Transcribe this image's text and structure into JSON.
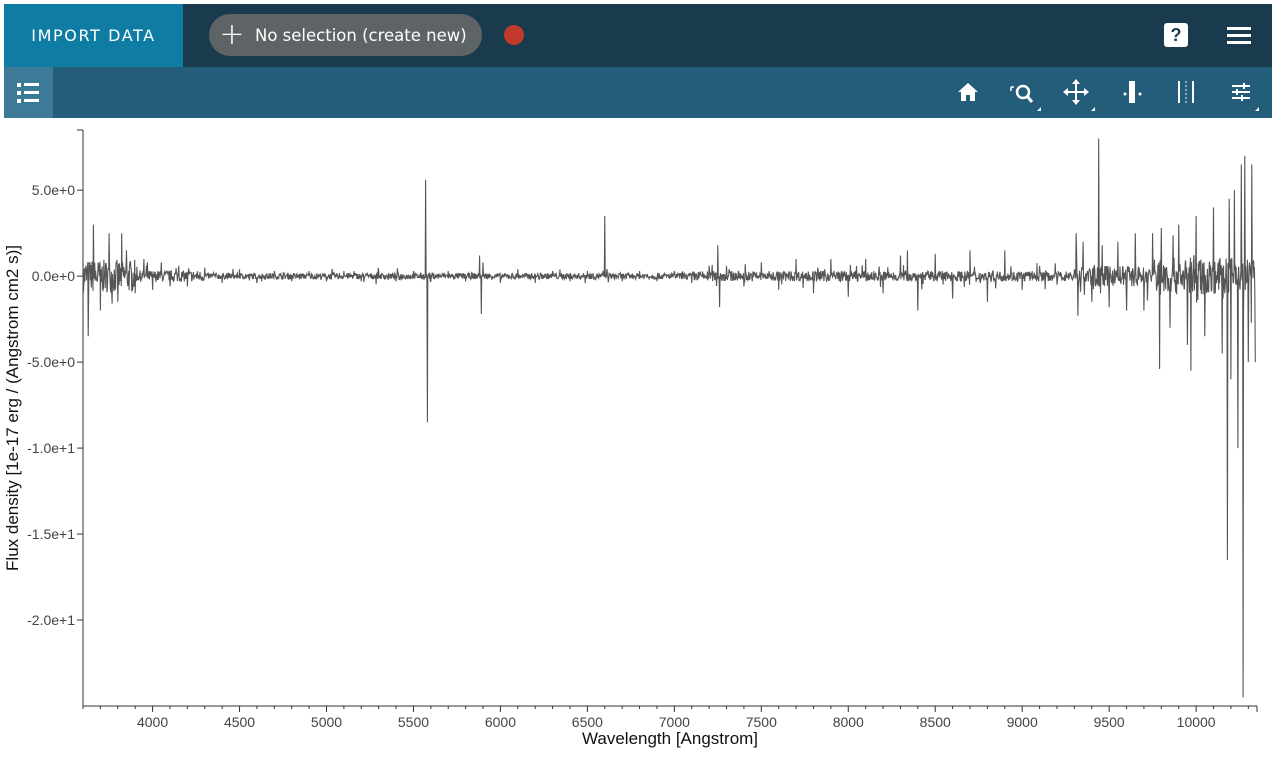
{
  "topbar": {
    "import_label": "IMPORT DATA",
    "selection_label": "No selection (create new)",
    "selection_icon": "plus-icon",
    "status_color": "#c23a2b",
    "help_label": "?",
    "help_icon": "help-icon",
    "menu_icon": "hamburger-menu-icon"
  },
  "toolbar": {
    "tools": [
      {
        "name": "home-icon"
      },
      {
        "name": "zoom-icon"
      },
      {
        "name": "pan-icon"
      },
      {
        "name": "single-pixel-select-icon"
      },
      {
        "name": "range-select-icon"
      },
      {
        "name": "settings-sliders-icon"
      }
    ],
    "colors": {
      "topbar": "#1a3a4d",
      "toolbar": "#245d7a",
      "import": "#0f7ca3"
    }
  },
  "chart_data": {
    "type": "line",
    "xlabel": "Wavelength [Angstrom]",
    "ylabel": "Flux density [1e-17 erg / (Angstrom cm2 s)]",
    "xlim": [
      3600,
      10350
    ],
    "ylim": [
      -25,
      8.5
    ],
    "xticks": [
      4000,
      4500,
      5000,
      5500,
      6000,
      6500,
      7000,
      7500,
      8000,
      8500,
      9000,
      9500,
      10000
    ],
    "xtick_labels": [
      "4000",
      "4500",
      "5000",
      "5500",
      "6000",
      "6500",
      "7000",
      "7500",
      "8000",
      "8500",
      "9000",
      "9500",
      "10000"
    ],
    "yticks": [
      5,
      0,
      -5,
      -10,
      -15,
      -20
    ],
    "ytick_labels": [
      "5.0e+0",
      "0.0e+0",
      "-5.0e+0",
      "-1.0e+1",
      "-1.5e+1",
      "-2.0e+1"
    ],
    "series_color": "#555555",
    "grid": false,
    "series": [
      {
        "x": [
          3600,
          3630,
          3660,
          3700,
          3750,
          3800,
          3850,
          3900,
          3950,
          4000,
          4050,
          4100,
          4150,
          4200,
          4300,
          4400,
          4500,
          4600,
          4700,
          4800,
          4900,
          5000,
          5100,
          5200,
          5300,
          5400,
          5500,
          5570,
          5580,
          5590,
          5600,
          5700,
          5800,
          5880,
          5890,
          5900,
          6000,
          6100,
          6200,
          6300,
          6400,
          6500,
          6590,
          6600,
          6610,
          6700,
          6800,
          6900,
          7000,
          7100,
          7200,
          7250,
          7260,
          7300,
          7400,
          7500,
          7600,
          7700,
          7800,
          7900,
          8000,
          8100,
          8200,
          8300,
          8340,
          8400,
          8500,
          8600,
          8700,
          8800,
          8900,
          9000,
          9100,
          9200,
          9300,
          9310,
          9320,
          9350,
          9400,
          9440,
          9450,
          9460,
          9500,
          9550,
          9600,
          9650,
          9700,
          9750,
          9790,
          9800,
          9850,
          9900,
          9950,
          9970,
          10000,
          10050,
          10100,
          10150,
          10180,
          10190,
          10200,
          10220,
          10240,
          10260,
          10270,
          10280,
          10300,
          10320,
          10340
        ],
        "y": [
          0.0,
          -3.5,
          3.0,
          -2.0,
          2.5,
          -1.5,
          1.5,
          -1.0,
          1.0,
          -0.8,
          0.8,
          -0.6,
          0.6,
          -0.6,
          0.5,
          -0.4,
          0.4,
          -0.4,
          0.3,
          -0.3,
          0.3,
          -0.3,
          0.3,
          -0.3,
          0.3,
          -0.3,
          0.3,
          5.6,
          -8.5,
          0.2,
          -0.3,
          0.3,
          -0.3,
          1.2,
          -2.2,
          0.8,
          -0.4,
          0.4,
          -0.4,
          0.3,
          -0.3,
          0.3,
          0.3,
          3.5,
          0.2,
          -0.3,
          0.3,
          -0.3,
          0.3,
          -0.4,
          0.6,
          1.8,
          -1.8,
          0.6,
          -0.6,
          0.8,
          -0.8,
          1.0,
          -1.0,
          1.0,
          -1.2,
          1.0,
          -1.0,
          1.2,
          1.5,
          -2.0,
          1.3,
          -1.3,
          1.5,
          -1.5,
          1.5,
          -0.8,
          0.6,
          -0.5,
          0.4,
          2.5,
          -2.3,
          2.0,
          -1.5,
          8.0,
          -1.0,
          1.8,
          -1.8,
          2.0,
          -2.0,
          2.5,
          -2.0,
          2.5,
          -5.4,
          2.8,
          -3.0,
          3.0,
          -4.0,
          -5.5,
          3.5,
          -3.5,
          4.0,
          -4.5,
          -16.5,
          4.5,
          -6.0,
          5.0,
          -10.0,
          6.5,
          -24.5,
          7.0,
          -5.0,
          6.5,
          -5.0
        ]
      }
    ]
  }
}
